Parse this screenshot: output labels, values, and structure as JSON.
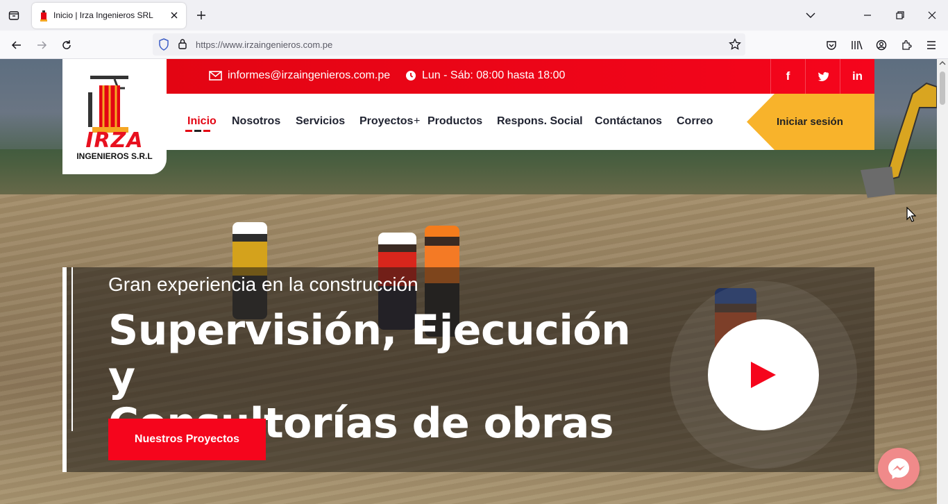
{
  "browser": {
    "tab_title": "Inicio | Irza Ingenieros SRL",
    "url": "https://www.irzaingenieros.com.pe",
    "icons": [
      "tab-list-icon",
      "close-icon",
      "plus-icon",
      "chevron-down-icon",
      "minimize-icon",
      "restore-icon",
      "close-window-icon",
      "back-icon",
      "forward-icon",
      "reload-icon",
      "shield-icon",
      "lock-icon",
      "star-icon",
      "pocket-icon",
      "library-icon",
      "account-icon",
      "extensions-icon",
      "menu-icon"
    ]
  },
  "site": {
    "logo": {
      "name": "IRZA",
      "subtitle": "INGENIEROS S.R.L"
    },
    "topbar": {
      "email": "informes@irzaingenieros.com.pe",
      "hours": "Lun - Sáb: 08:00 hasta 18:00",
      "social": [
        "f",
        "t",
        "in"
      ]
    },
    "menu": [
      {
        "label": "Inicio",
        "active": true
      },
      {
        "label": "Nosotros"
      },
      {
        "label": "Servicios"
      },
      {
        "label": "Proyectos"
      },
      {
        "label": "+"
      },
      {
        "label": "Productos"
      },
      {
        "label": "Respons. Social"
      },
      {
        "label": "Contáctanos"
      },
      {
        "label": "Correo"
      }
    ],
    "login_label": "Iniciar sesión",
    "hero": {
      "subtitle": "Gran experiencia en la construcción",
      "title_line1": "Supervisión, Ejecución y",
      "title_line2": "Consultorías de obras",
      "cta_label": "Nuestros Proyectos"
    },
    "colors": {
      "brand_red": "#e30513",
      "login_yellow": "#f8b32b",
      "messenger": "#f08a8a"
    }
  }
}
